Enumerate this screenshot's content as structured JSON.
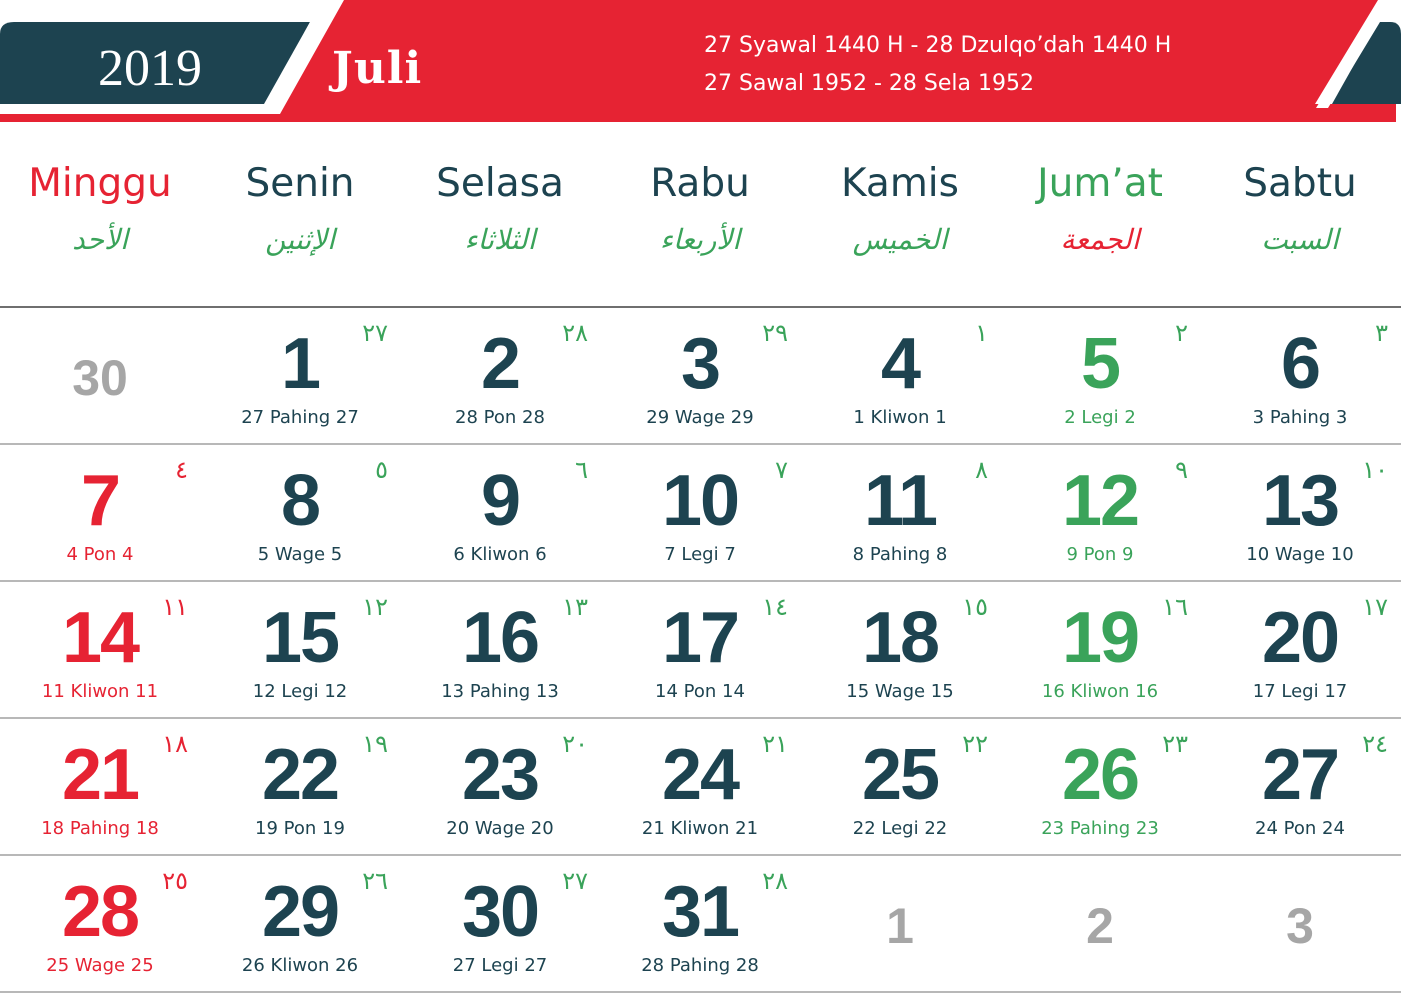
{
  "header": {
    "year": "2019",
    "month": "Juli",
    "hijri_line1": "27  Syawal 1440 H - 28 Dzulqo’dah 1440 H",
    "hijri_line2": "27  Sawal 1952 - 28 Sela 1952"
  },
  "colors": {
    "navy": "#1d4350",
    "red": "#e62333",
    "green": "#3aa35a",
    "gray": "#a6a6a6"
  },
  "weekdays": [
    {
      "name": "Minggu",
      "arabic": "الأحد"
    },
    {
      "name": "Senin",
      "arabic": "الإثنين"
    },
    {
      "name": "Selasa",
      "arabic": "الثلاثاء"
    },
    {
      "name": "Rabu",
      "arabic": "الأربعاء"
    },
    {
      "name": "Kamis",
      "arabic": "الخميس"
    },
    {
      "name": "Jum’at",
      "arabic": "الجمعة"
    },
    {
      "name": "Sabtu",
      "arabic": "السبت"
    }
  ],
  "weeks": [
    [
      {
        "day": "30",
        "other_month": true
      },
      {
        "day": "1",
        "pasaran": "27 Pahing 27",
        "hijri": "٢٧"
      },
      {
        "day": "2",
        "pasaran": "28 Pon 28",
        "hijri": "٢٨"
      },
      {
        "day": "3",
        "pasaran": "29 Wage 29",
        "hijri": "٢٩"
      },
      {
        "day": "4",
        "pasaran": "1 Kliwon 1",
        "hijri": "١"
      },
      {
        "day": "5",
        "pasaran": "2 Legi 2",
        "hijri": "٢"
      },
      {
        "day": "6",
        "pasaran": "3 Pahing 3",
        "hijri": "٣"
      }
    ],
    [
      {
        "day": "7",
        "pasaran": "4 Pon 4",
        "hijri": "٤"
      },
      {
        "day": "8",
        "pasaran": "5 Wage 5",
        "hijri": "٥"
      },
      {
        "day": "9",
        "pasaran": "6 Kliwon 6",
        "hijri": "٦"
      },
      {
        "day": "10",
        "pasaran": "7 Legi 7",
        "hijri": "٧"
      },
      {
        "day": "11",
        "pasaran": "8 Pahing 8",
        "hijri": "٨"
      },
      {
        "day": "12",
        "pasaran": "9 Pon 9",
        "hijri": "٩"
      },
      {
        "day": "13",
        "pasaran": "10 Wage 10",
        "hijri": "١٠"
      }
    ],
    [
      {
        "day": "14",
        "pasaran": "11 Kliwon 11",
        "hijri": "١١"
      },
      {
        "day": "15",
        "pasaran": "12 Legi 12",
        "hijri": "١٢"
      },
      {
        "day": "16",
        "pasaran": "13 Pahing 13",
        "hijri": "١٣"
      },
      {
        "day": "17",
        "pasaran": "14 Pon 14",
        "hijri": "١٤"
      },
      {
        "day": "18",
        "pasaran": "15 Wage 15",
        "hijri": "١٥"
      },
      {
        "day": "19",
        "pasaran": "16 Kliwon 16",
        "hijri": "١٦"
      },
      {
        "day": "20",
        "pasaran": "17 Legi 17",
        "hijri": "١٧"
      }
    ],
    [
      {
        "day": "21",
        "pasaran": "18 Pahing 18",
        "hijri": "١٨"
      },
      {
        "day": "22",
        "pasaran": "19 Pon 19",
        "hijri": "١٩"
      },
      {
        "day": "23",
        "pasaran": "20 Wage 20",
        "hijri": "٢٠"
      },
      {
        "day": "24",
        "pasaran": "21 Kliwon 21",
        "hijri": "٢١"
      },
      {
        "day": "25",
        "pasaran": "22 Legi 22",
        "hijri": "٢٢"
      },
      {
        "day": "26",
        "pasaran": "23 Pahing 23",
        "hijri": "٢٣"
      },
      {
        "day": "27",
        "pasaran": "24 Pon 24",
        "hijri": "٢٤"
      }
    ],
    [
      {
        "day": "28",
        "pasaran": "25 Wage 25",
        "hijri": "٢٥"
      },
      {
        "day": "29",
        "pasaran": "26 Kliwon 26",
        "hijri": "٢٦"
      },
      {
        "day": "30",
        "pasaran": "27 Legi 27",
        "hijri": "٢٧"
      },
      {
        "day": "31",
        "pasaran": "28 Pahing 28",
        "hijri": "٢٨"
      },
      {
        "day": "1",
        "other_month": true
      },
      {
        "day": "2",
        "other_month": true
      },
      {
        "day": "3",
        "other_month": true
      }
    ]
  ]
}
